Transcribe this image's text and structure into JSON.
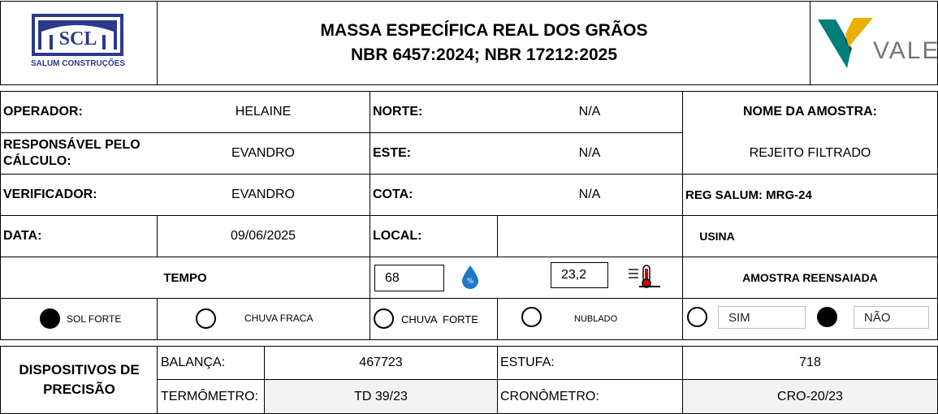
{
  "header": {
    "logo_left": {
      "text": "SCL",
      "subtitle": "SALUM CONSTRUÇÕES",
      "color": "#2a3a8c"
    },
    "title_line1": "MASSA ESPECÍFICA REAL DOS GRÃOS",
    "title_line2": "NBR 6457:2024; NBR 17212:2025",
    "logo_right": {
      "text": "VALE",
      "colors": {
        "green": "#007e7a",
        "yellow": "#eab000",
        "gray": "#747678"
      }
    }
  },
  "info": {
    "operador": {
      "label": "OPERADOR:",
      "value": "HELAINE"
    },
    "responsavel": {
      "label": "RESPONSÁVEL PELO CÁLCULO:",
      "value": "EVANDRO"
    },
    "verificador": {
      "label": "VERIFICADOR:",
      "value": "EVANDRO"
    },
    "data": {
      "label": "DATA:",
      "value": "09/06/2025"
    },
    "norte": {
      "label": "NORTE:",
      "value": "N/A"
    },
    "este": {
      "label": "ESTE:",
      "value": "N/A"
    },
    "cota": {
      "label": "COTA:",
      "value": "N/A"
    },
    "local": {
      "label": "LOCAL:",
      "value": "USINA"
    },
    "nome_amostra": {
      "label": "NOME DA AMOSTRA:",
      "value": "REJEITO FILTRADO"
    },
    "reg_salum": "REG SALUM: MRG-24"
  },
  "tempo": {
    "label": "TEMPO",
    "humidity": "68",
    "humidity_icon": "humidity-drop-icon",
    "temperature": "23,2",
    "temperature_icon": "thermometer-icon",
    "amostra_reensaiada": "AMOSTRA REENSAIADA"
  },
  "weather": [
    {
      "label": "SOL FORTE",
      "selected": true
    },
    {
      "label": "CHUVA FRACA",
      "selected": false
    },
    {
      "label": "CHUVA  FORTE",
      "selected": false
    },
    {
      "label": "NUBLADO",
      "selected": false
    }
  ],
  "reensaio": [
    {
      "label": "SIM",
      "selected": false
    },
    {
      "label": "NÃO",
      "selected": true
    }
  ],
  "dispositivos": {
    "title": "DISPOSITIVOS DE PRECISÃO",
    "balanca": {
      "label": "BALANÇA:",
      "value": "467723"
    },
    "estufa": {
      "label": "ESTUFA:",
      "value": "718"
    },
    "termometro": {
      "label": "TERMÔMETRO:",
      "value": "TD 39/23"
    },
    "cronometro": {
      "label": "CRONÔMETRO:",
      "value": "CRO-20/23"
    }
  }
}
